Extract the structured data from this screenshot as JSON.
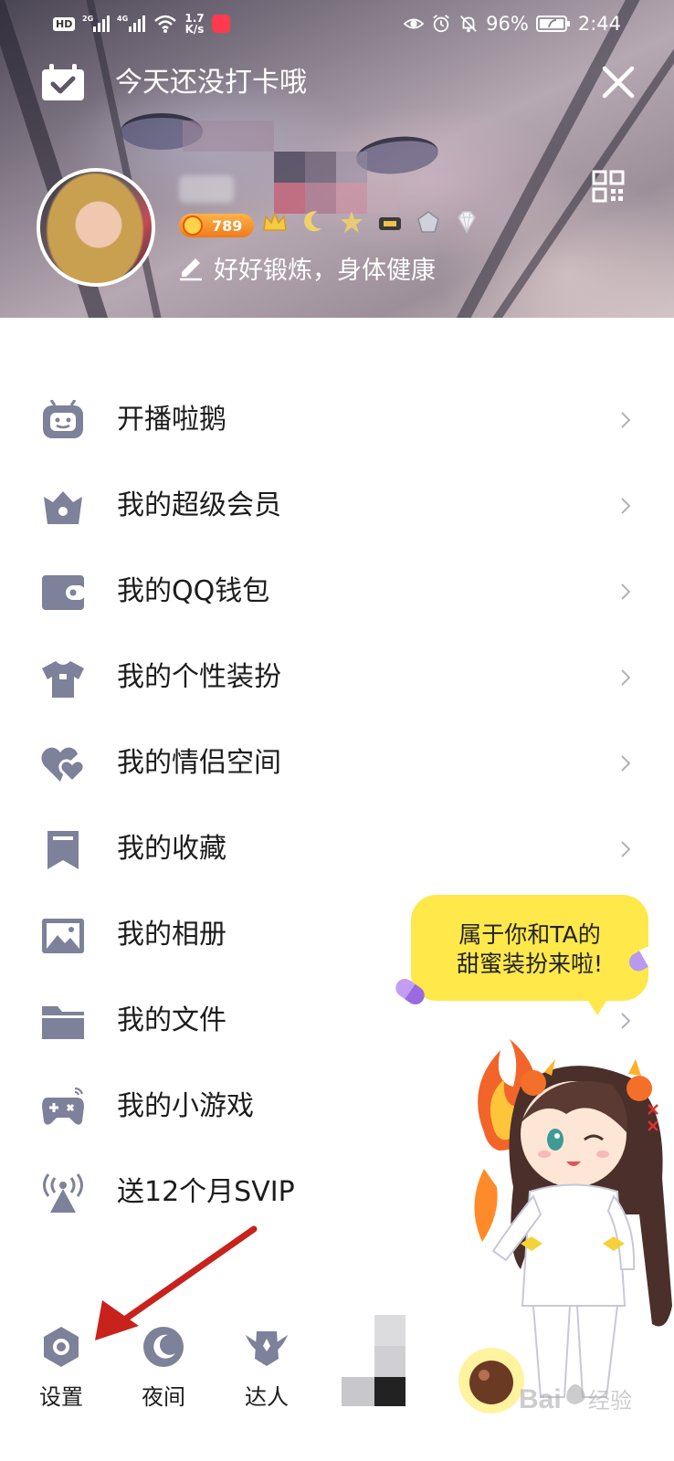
{
  "status_bar": {
    "hd": "HD",
    "net_speed_value": "1.7",
    "net_speed_unit": "K/s",
    "battery": "96%",
    "time": "2:44"
  },
  "header": {
    "checkin_text": "今天还没打卡哦",
    "coin_value": "789",
    "signature": "好好锻炼，身体健康"
  },
  "menu": {
    "items": [
      {
        "label": "开播啦鹅",
        "icon": "tv-robot-icon"
      },
      {
        "label": "我的超级会员",
        "icon": "crown-bag-icon"
      },
      {
        "label": "我的QQ钱包",
        "icon": "wallet-icon"
      },
      {
        "label": "我的个性装扮",
        "icon": "tshirt-icon"
      },
      {
        "label": "我的情侣空间",
        "icon": "hearts-icon"
      },
      {
        "label": "我的收藏",
        "icon": "bookmark-icon"
      },
      {
        "label": "我的相册",
        "icon": "photo-icon"
      },
      {
        "label": "我的文件",
        "icon": "folder-icon"
      },
      {
        "label": "我的小游戏",
        "icon": "gamepad-icon"
      },
      {
        "label": "送12个月SVIP",
        "icon": "broadcast-icon"
      }
    ]
  },
  "promo": {
    "line1": "属于你和TA的",
    "line2": "甜蜜装扮来啦!"
  },
  "toolbar": {
    "settings": "设置",
    "night": "夜间",
    "expert": "达人"
  },
  "colors": {
    "icon": "#7d8199",
    "bubble": "#ffe84a",
    "arrow": "#c8221c",
    "coin_badge": "#f07a1a"
  }
}
